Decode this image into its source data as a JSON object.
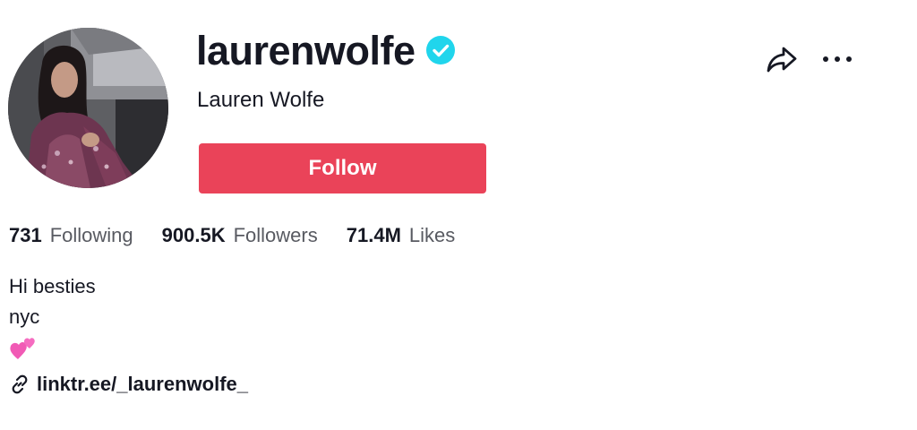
{
  "profile": {
    "username": "laurenwolfe",
    "display_name": "Lauren Wolfe",
    "verified": true,
    "follow_label": "Follow"
  },
  "stats": [
    {
      "value": "731",
      "label": "Following"
    },
    {
      "value": "900.5K",
      "label": "Followers"
    },
    {
      "value": "71.4M",
      "label": "Likes"
    }
  ],
  "bio": {
    "lines": [
      "Hi besties",
      "nyc"
    ],
    "emoji": "💕"
  },
  "link": {
    "text": "linktr.ee/_laurenwolfe_"
  },
  "icons": {
    "verified": "verified-badge-icon",
    "share": "share-icon",
    "more": "more-icon",
    "link": "link-icon"
  },
  "colors": {
    "follow_button": "#ea4359",
    "verified": "#20d5ec",
    "text_primary": "#161823",
    "text_secondary": "#585a61"
  }
}
